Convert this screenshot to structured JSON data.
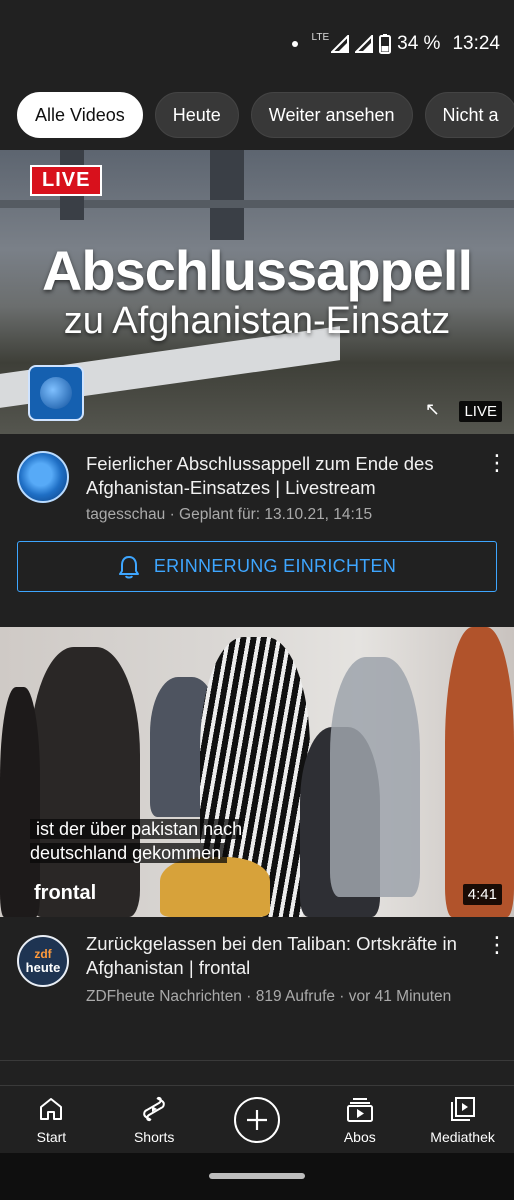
{
  "status_bar": {
    "network": "LTE",
    "battery": "34 %",
    "time": "13:24"
  },
  "chips": [
    {
      "label": "Alle Videos",
      "active": true
    },
    {
      "label": "Heute",
      "active": false
    },
    {
      "label": "Weiter ansehen",
      "active": false
    },
    {
      "label": "Nicht a",
      "active": false
    }
  ],
  "video1": {
    "thumbnail": {
      "live_badge": "LIVE",
      "headline_line1": "Abschlussappell",
      "headline_line2": "zu Afghanistan-Einsatz",
      "corner_label": "LIVE"
    },
    "title": "Feierlicher Abschlussappell zum Ende des Afghanistan-Einsatzes | Livestream",
    "subtitle": "tagesschau · Geplant für: 13.10.21, 14:15",
    "reminder_button": "ERINNERUNG EINRICHTEN"
  },
  "video2": {
    "thumbnail": {
      "caption": "ist der über pakistan nach deutschland gekommen",
      "brand_overlay": "frontal",
      "duration": "4:41"
    },
    "channel_avatar": {
      "line1": "zdf",
      "line2": "heute"
    },
    "title": "Zurückgelassen bei den Taliban: Ortskräfte in Afghanistan | frontal",
    "subtitle": "ZDFheute Nachrichten · 819 Aufrufe · vor 41 Minuten"
  },
  "bottom_nav": [
    {
      "label": "Start",
      "icon": "home-icon"
    },
    {
      "label": "Shorts",
      "icon": "shorts-icon"
    },
    {
      "label": "",
      "icon": "create-icon"
    },
    {
      "label": "Abos",
      "icon": "subscriptions-icon"
    },
    {
      "label": "Mediathek",
      "icon": "library-icon"
    }
  ],
  "colors": {
    "background": "#212121",
    "accent_blue": "#3ea6ff",
    "live_red": "#d8111c"
  }
}
